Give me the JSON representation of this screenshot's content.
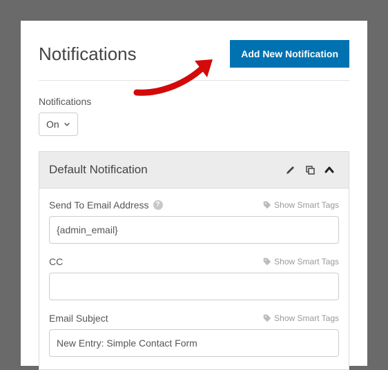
{
  "header": {
    "title": "Notifications",
    "add_button": "Add New Notification"
  },
  "notifications_toggle": {
    "label": "Notifications",
    "value": "On"
  },
  "card": {
    "title": "Default Notification",
    "fields": {
      "send_to": {
        "label": "Send To Email Address",
        "smart_tags": "Show Smart Tags",
        "value": "{admin_email}"
      },
      "cc": {
        "label": "CC",
        "smart_tags": "Show Smart Tags",
        "value": ""
      },
      "subject": {
        "label": "Email Subject",
        "smart_tags": "Show Smart Tags",
        "value": "New Entry: Simple Contact Form"
      }
    }
  }
}
